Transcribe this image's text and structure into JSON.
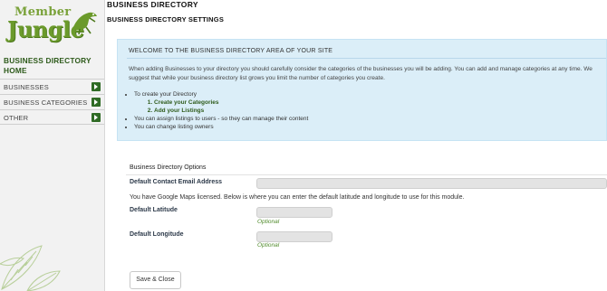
{
  "logo": {
    "line1": "Member",
    "line2": "Jungle"
  },
  "sidebar": {
    "home": "BUSINESS DIRECTORY HOME",
    "items": [
      {
        "label": "BUSINESSES",
        "icon": "arrow-right-icon"
      },
      {
        "label": "BUSINESS CATEGORIES",
        "icon": "arrow-right-icon"
      },
      {
        "label": "OTHER",
        "icon": "arrow-right-icon"
      }
    ]
  },
  "header": {
    "title": "BUSINESS DIRECTORY",
    "subtitle": "BUSINESS DIRECTORY SETTINGS"
  },
  "welcome": {
    "title": "WELCOME TO THE BUSINESS DIRECTORY AREA OF YOUR SITE",
    "paragraph": "When adding Businesses to your directory you should carefully consider the categories of the businesses you will be adding. You can add and manage categories at any time. We suggest that while your business directory list grows you limit the number of categories you create.",
    "to_create": "To create your Directory",
    "steps": [
      "Create your Categories",
      "Add your Listings"
    ],
    "tips": [
      "You can assign listings to users - so they can manage their content",
      "You can change listing owners"
    ]
  },
  "options": {
    "header": "Business Directory Options",
    "email_label": "Default Contact Email Address",
    "email_value": "",
    "maps_note": "You have Google Maps licensed. Below is where you can enter the default latitude and longitude to use for this module.",
    "latitude_label": "Default Latitude",
    "latitude_value": "",
    "latitude_hint": "Optional",
    "longitude_label": "Default Longitude",
    "longitude_value": "",
    "longitude_hint": "Optional"
  },
  "actions": {
    "save_close": "Save & Close"
  },
  "colors": {
    "brand_green": "#6b9a2b",
    "dark_green": "#2f6b25",
    "info_bg": "#dbeef8"
  }
}
